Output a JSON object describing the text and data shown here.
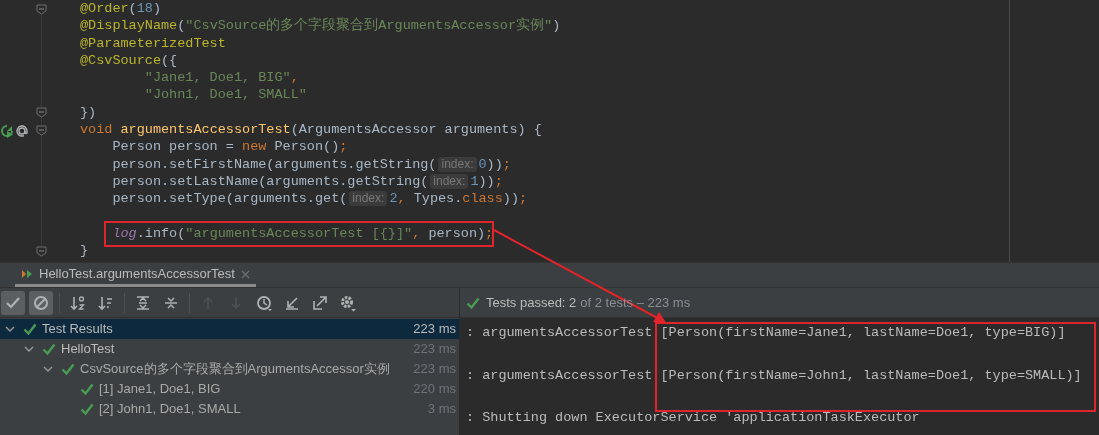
{
  "editor": {
    "lines": [
      {
        "fold": true,
        "segments": [
          {
            "kind": "annotation",
            "text": "@Order"
          },
          {
            "kind": "plain",
            "text": "("
          },
          {
            "kind": "number",
            "text": "18"
          },
          {
            "kind": "plain",
            "text": ")"
          }
        ]
      },
      {
        "segments": [
          {
            "kind": "annotation",
            "text": "@DisplayName"
          },
          {
            "kind": "plain",
            "text": "("
          },
          {
            "kind": "string",
            "text": "\"CsvSource的多个字段聚合到ArgumentsAccessor实例\""
          },
          {
            "kind": "plain",
            "text": ")"
          }
        ]
      },
      {
        "segments": [
          {
            "kind": "annotation",
            "text": "@ParameterizedTest"
          }
        ]
      },
      {
        "segments": [
          {
            "kind": "annotation",
            "text": "@CsvSource"
          },
          {
            "kind": "plain",
            "text": "({"
          }
        ]
      },
      {
        "segments": [
          {
            "kind": "string",
            "text": "        \"Jane1, Doe1, BIG\""
          },
          {
            "kind": "keyword",
            "text": ","
          }
        ]
      },
      {
        "segments": [
          {
            "kind": "string",
            "text": "        \"John1, Doe1, SMALL\""
          }
        ]
      },
      {
        "fold": true,
        "segments": [
          {
            "kind": "plain",
            "text": "})"
          }
        ]
      },
      {
        "fold": true,
        "run_marker": true,
        "segments": [
          {
            "kind": "keyword",
            "text": "void "
          },
          {
            "kind": "method",
            "text": "argumentsAccessorTest"
          },
          {
            "kind": "plain",
            "text": "(ArgumentsAccessor arguments) {"
          }
        ]
      },
      {
        "segments": [
          {
            "kind": "plain",
            "text": "    Person person = "
          },
          {
            "kind": "keyword",
            "text": "new "
          },
          {
            "kind": "plain",
            "text": "Person()"
          },
          {
            "kind": "keyword",
            "text": ";"
          }
        ]
      },
      {
        "segments": [
          {
            "kind": "plain",
            "text": "    person.setFirstName(arguments.getString("
          },
          {
            "kind": "hint",
            "text": "index:"
          },
          {
            "kind": "number",
            "text": "0"
          },
          {
            "kind": "plain",
            "text": "))"
          },
          {
            "kind": "keyword",
            "text": ";"
          }
        ]
      },
      {
        "segments": [
          {
            "kind": "plain",
            "text": "    person.setLastName(arguments.getString("
          },
          {
            "kind": "hint",
            "text": "index:"
          },
          {
            "kind": "number",
            "text": "1"
          },
          {
            "kind": "plain",
            "text": "))"
          },
          {
            "kind": "keyword",
            "text": ";"
          }
        ]
      },
      {
        "segments": [
          {
            "kind": "plain",
            "text": "    person.setType(arguments.get("
          },
          {
            "kind": "hint",
            "text": "index:"
          },
          {
            "kind": "number",
            "text": "2"
          },
          {
            "kind": "keyword",
            "text": ", "
          },
          {
            "kind": "plain",
            "text": "Types."
          },
          {
            "kind": "keyword",
            "text": "class"
          },
          {
            "kind": "plain",
            "text": "))"
          },
          {
            "kind": "keyword",
            "text": ";"
          }
        ]
      },
      {
        "highlighted": true,
        "blank_before": true,
        "segments": [
          {
            "kind": "field",
            "text": "    log"
          },
          {
            "kind": "plain",
            "text": ".info("
          },
          {
            "kind": "string",
            "text": "\"argumentsAccessorTest [{}]\""
          },
          {
            "kind": "keyword",
            "text": ", "
          },
          {
            "kind": "plain",
            "text": "person)"
          },
          {
            "kind": "keyword",
            "text": ";"
          }
        ]
      },
      {
        "fold": true,
        "segments": [
          {
            "kind": "plain",
            "text": "}"
          }
        ]
      }
    ]
  },
  "run_tab": {
    "label": "HelloTest.argumentsAccessorTest",
    "selected": true
  },
  "toolbar": [
    {
      "kind": "passed",
      "selected": true
    },
    {
      "kind": "ignored",
      "selected": true
    },
    {
      "kind": "sort-alpha",
      "selected": false
    },
    {
      "kind": "sort-duration",
      "selected": false
    },
    {
      "kind": "expand",
      "selected": false
    },
    {
      "kind": "collapse",
      "selected": false
    },
    {
      "kind": "up",
      "selected": false,
      "disabled": true
    },
    {
      "kind": "down",
      "selected": false,
      "disabled": true
    },
    {
      "kind": "history",
      "selected": false
    },
    {
      "kind": "import",
      "selected": false
    },
    {
      "kind": "export",
      "selected": false
    },
    {
      "kind": "settings",
      "selected": false
    }
  ],
  "tree": [
    {
      "label": "Test Results",
      "time": "223 ms",
      "expanded": true,
      "selected": true,
      "children": [
        {
          "label": "HelloTest",
          "time": "223 ms",
          "expanded": true,
          "selected": false,
          "children": [
            {
              "label": "CsvSource的多个字段聚合到ArgumentsAccessor实例",
              "time": "223 ms",
              "expanded": true,
              "selected": false,
              "children": [
                {
                  "label": "[1] Jane1, Doe1, BIG",
                  "time": "220 ms",
                  "selected": false
                },
                {
                  "label": "[2] John1, Doe1, SMALL",
                  "time": "3 ms",
                  "selected": false
                }
              ]
            }
          ]
        }
      ]
    }
  ],
  "status": {
    "summary": "Tests passed: 2",
    "detail": "of 2 tests – 223 ms"
  },
  "console": {
    "lines": [
      {
        "text": ": argumentsAccessorTest [Person(firstName=Jane1, lastName=Doe1, type=BIG)]"
      },
      {
        "blank_before": true,
        "text": ": argumentsAccessorTest [Person(firstName=John1, lastName=Doe1, type=SMALL)]"
      },
      {
        "blank_before": true,
        "text": ": Shutting down ExecutorService 'applicationTaskExecutor"
      }
    ]
  }
}
